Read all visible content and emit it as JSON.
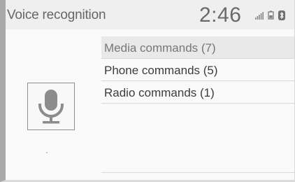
{
  "header": {
    "title": "Voice recognition",
    "clock": "2:46",
    "status_icons": [
      "signal-bars-icon",
      "battery-icon",
      "bluetooth-icon"
    ]
  },
  "mic_button": {
    "icon": "microphone-icon"
  },
  "menu": {
    "items": [
      {
        "label": "Media commands (7)",
        "selected": true
      },
      {
        "label": "Phone commands (5)",
        "selected": false
      },
      {
        "label": "Radio commands (1)",
        "selected": false
      }
    ]
  },
  "colors": {
    "background": "#fafafa",
    "header": "#efefef",
    "selected_row": "#e9e9e9",
    "text": "#3c3c3c"
  }
}
